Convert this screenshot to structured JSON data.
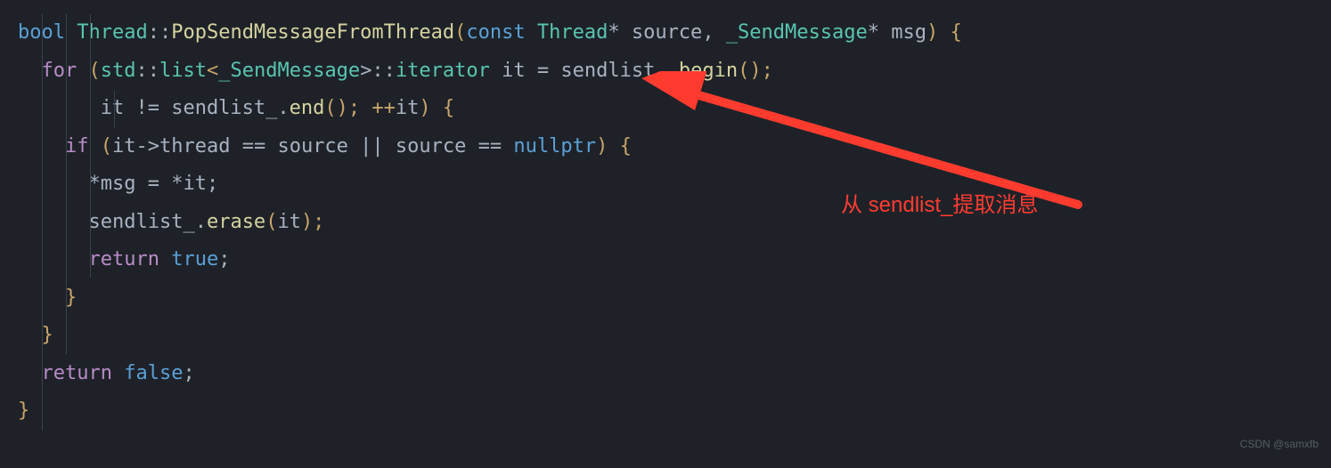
{
  "code": {
    "l1": {
      "t1": "bool",
      "t2": " ",
      "t3": "Thread",
      "t4": "::",
      "t5": "PopSendMessageFromThread",
      "t6": "(",
      "t7": "const",
      "t8": " ",
      "t9": "Thread",
      "t10": "* ",
      "t11": "source",
      "t12": ", ",
      "t13": "_SendMessage",
      "t14": "* ",
      "t15": "msg",
      "t16": ") ",
      "t17": "{"
    },
    "l2": {
      "t1": "  ",
      "t2": "for",
      "t3": " (",
      "t4": "std",
      "t5": "::",
      "t6": "list",
      "t7": "<",
      "t8": "_SendMessage",
      "t9": ">::",
      "t10": "iterator",
      "t11": " ",
      "t12": "it",
      "t13": " = ",
      "t14": "sendlist_",
      "t15": ".",
      "t16": "begin",
      "t17": "();"
    },
    "l3": {
      "t1": "       ",
      "t2": "it",
      "t3": " != ",
      "t4": "sendlist_",
      "t5": ".",
      "t6": "end",
      "t7": "(); ++",
      "t8": "it",
      "t9": ") ",
      "t10": "{"
    },
    "l4": {
      "t1": "    ",
      "t2": "if",
      "t3": " (",
      "t4": "it",
      "t5": "->",
      "t6": "thread",
      "t7": " == ",
      "t8": "source",
      "t9": " || ",
      "t10": "source",
      "t11": " == ",
      "t12": "nullptr",
      "t13": ") ",
      "t14": "{"
    },
    "l5": {
      "t1": "      *",
      "t2": "msg",
      "t3": " = *",
      "t4": "it",
      "t5": ";"
    },
    "l6": {
      "t1": "      ",
      "t2": "sendlist_",
      "t3": ".",
      "t4": "erase",
      "t5": "(",
      "t6": "it",
      "t7": ");"
    },
    "l7": {
      "t1": "      ",
      "t2": "return",
      "t3": " ",
      "t4": "true",
      "t5": ";"
    },
    "l8": {
      "t1": "    ",
      "t2": "}"
    },
    "l9": {
      "t1": "  ",
      "t2": "}"
    },
    "l10": {
      "t1": "  ",
      "t2": "return",
      "t3": " ",
      "t4": "false",
      "t5": ";"
    },
    "l11": {
      "t1": "}"
    }
  },
  "annotation": {
    "text": "从 sendlist_提取消息"
  },
  "watermark": {
    "text": "CSDN @samxfb"
  }
}
